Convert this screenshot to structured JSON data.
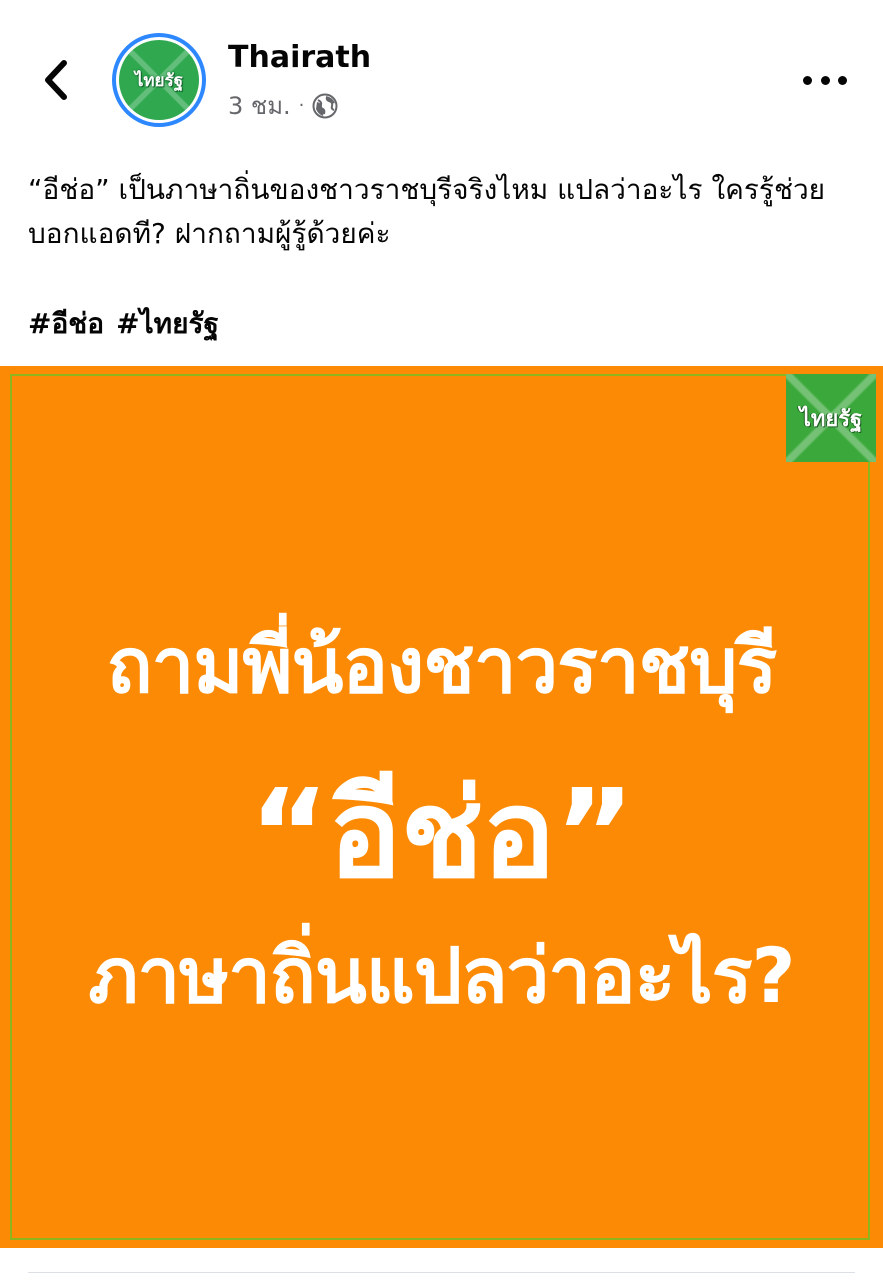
{
  "header": {
    "back_icon": "chevron-left-icon",
    "page_name": "Thairath",
    "avatar_text": "ไทยรัฐ",
    "time": "3 ชม.",
    "separator": "·",
    "privacy_icon": "globe-icon",
    "more_icon": "more-horizontal-icon"
  },
  "post": {
    "text": "“อีช่อ” เป็นภาษาถิ่นของชาวราชบุรีจริงไหม แปลว่าอะไร ใครรู้ช่วยบอกแอดที? ฝากถามผู้รู้ด้วยค่ะ",
    "hashtags": [
      "#อีช่อ",
      "#ไทยรัฐ"
    ]
  },
  "image": {
    "logo_text": "ไทยรัฐ",
    "line1": "ถามพี่น้องชาวราชบุรี",
    "line2": "“อีช่อ”",
    "line3": "ภาษาถิ่นแปลว่าอะไร?"
  },
  "colors": {
    "accent_blue": "#2d88ff",
    "image_bg": "#fc8a04",
    "brand_green": "#3aa83b",
    "secondary_text": "#65676b"
  }
}
